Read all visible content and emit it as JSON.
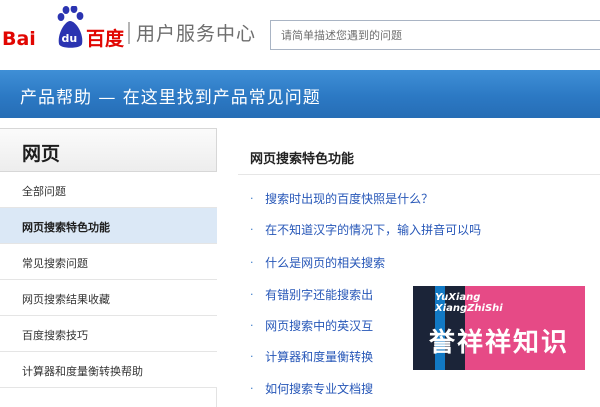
{
  "header": {
    "logo": {
      "text_bai": "Bai",
      "text_du": "du",
      "text_cn": "百度",
      "colors": {
        "red": "#e10602",
        "blue": "#2b34b1"
      }
    },
    "service_title": "用户服务中心",
    "search": {
      "placeholder": "请简单描述您遇到的问题"
    }
  },
  "banner": {
    "title": "产品帮助 — 在这里找到产品常见问题",
    "color": "#2c79c4"
  },
  "sidebar": {
    "title": "网页",
    "items": [
      {
        "label": "全部问题",
        "active": false
      },
      {
        "label": "网页搜索特色功能",
        "active": true
      },
      {
        "label": "常见搜索问题",
        "active": false
      },
      {
        "label": "网页搜索结果收藏",
        "active": false
      },
      {
        "label": "百度搜索技巧",
        "active": false
      },
      {
        "label": "计算器和度量衡转换帮助",
        "active": false
      }
    ]
  },
  "content": {
    "title": "网页搜索特色功能",
    "bullet": "·",
    "faq": [
      "搜索时出现的百度快照是什么？",
      "在不知道汉字的情况下，输入拼音可以吗",
      "什么是网页的相关搜索",
      "有错别字还能搜索出",
      "网页搜索中的英汉互",
      "计算器和度量衡转换",
      "如何搜索专业文档搜"
    ],
    "link_color": "#2757b8"
  },
  "watermark": {
    "en_line1": "YuXiang",
    "en_line2": "XiangZhiShi",
    "cn": "誉祥祥知识",
    "colors": {
      "dark": "#1b2438",
      "blue": "#1279c4",
      "pink": "#e64a86"
    }
  }
}
